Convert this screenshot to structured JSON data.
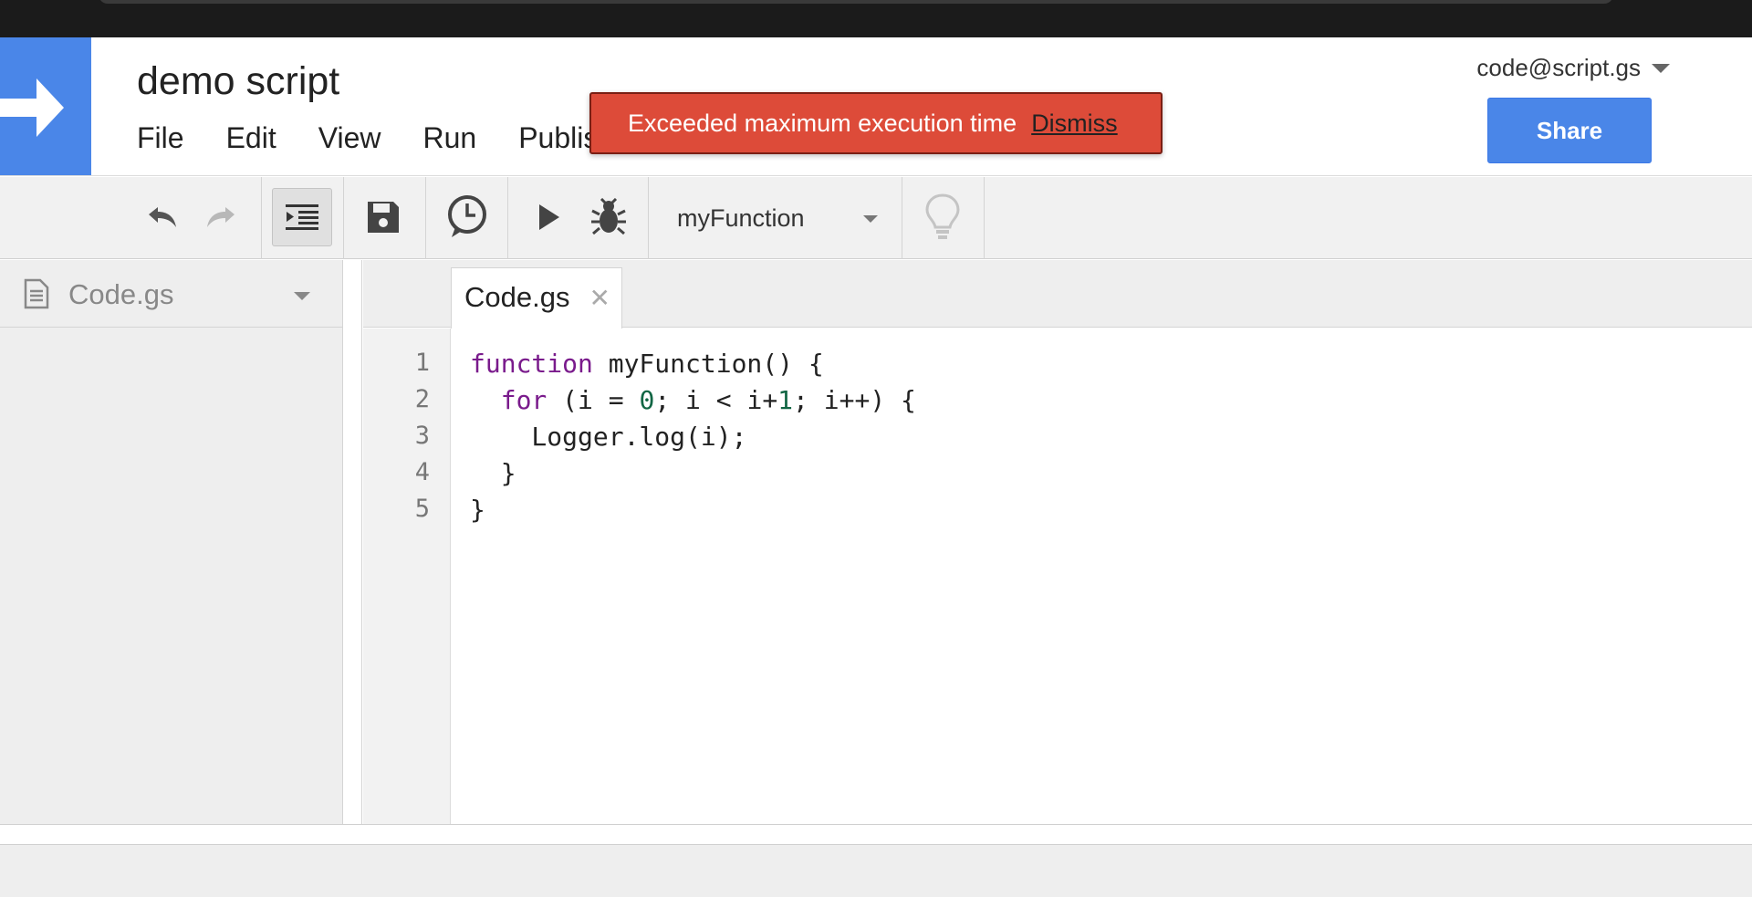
{
  "app": {
    "title": "demo script",
    "account": "code@script.gs",
    "share_label": "Share"
  },
  "menu": [
    "File",
    "Edit",
    "View",
    "Run",
    "Publish"
  ],
  "toast": {
    "message": "Exceeded maximum execution time",
    "action": "Dismiss"
  },
  "toolbar": {
    "function_select": "myFunction",
    "icons": [
      "undo-icon",
      "redo-icon",
      "indent-icon",
      "save-icon",
      "triggers-clock-icon",
      "run-icon",
      "debug-bug-icon",
      "lightbulb-icon"
    ]
  },
  "files": {
    "current": "Code.gs"
  },
  "editor": {
    "tab_label": "Code.gs",
    "close_glyph": "✕",
    "line_numbers": [
      "1",
      "2",
      "3",
      "4",
      "5"
    ],
    "lines": [
      [
        {
          "t": "function",
          "c": "kw"
        },
        {
          "t": " myFunction() {",
          "c": ""
        }
      ],
      [
        {
          "t": "  ",
          "c": ""
        },
        {
          "t": "for",
          "c": "kw"
        },
        {
          "t": " (i = ",
          "c": ""
        },
        {
          "t": "0",
          "c": "num"
        },
        {
          "t": "; i < i+",
          "c": ""
        },
        {
          "t": "1",
          "c": "num"
        },
        {
          "t": "; i++) {",
          "c": ""
        }
      ],
      [
        {
          "t": "    Logger.log(i);",
          "c": ""
        }
      ],
      [
        {
          "t": "  }",
          "c": ""
        }
      ],
      [
        {
          "t": "}",
          "c": ""
        }
      ]
    ]
  },
  "colors": {
    "brand_blue": "#4a86e8",
    "error_red": "#dd4b39",
    "keyword": "#7a1b8c",
    "number": "#116644"
  }
}
